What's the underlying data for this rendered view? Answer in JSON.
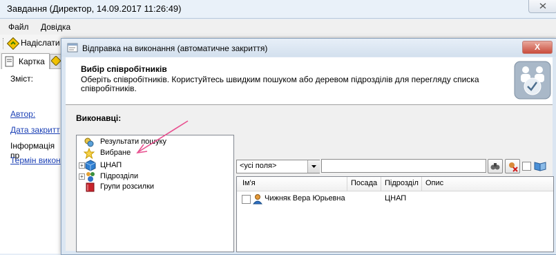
{
  "main_window": {
    "title": "Завдання (Директор, 14.09.2017 11:26:49)",
    "menu": [
      "Файл",
      "Довідка"
    ],
    "toolbar": {
      "send_label": "Надіслати"
    },
    "tab": {
      "label": "Картка"
    },
    "fields": {
      "content_label": "Зміст:",
      "author_link": "Автор:",
      "close_date_link": "Дата закритт",
      "info_label": "Інформація пр",
      "deadline_link": "Термін викон"
    }
  },
  "dialog": {
    "title": "Відправка на виконання (автоматичне закриття)",
    "header_title": "Вибір співробітників",
    "header_desc_line1": "Оберіть співробітників. Користуйтесь швидким пошуком або деревом підрозділів для перегляду списка",
    "header_desc_line2": "співробітників.",
    "executors_label": "Виконавці:",
    "close_glyph": "X",
    "tree": [
      {
        "label": "Результати пошуку",
        "icon": "search-results-icon",
        "expandable": false
      },
      {
        "label": "Вибране",
        "icon": "star-icon",
        "expandable": false
      },
      {
        "label": "ЦНАП",
        "icon": "cube-icon",
        "expandable": true
      },
      {
        "label": "Підрозділи",
        "icon": "departments-icon",
        "expandable": true
      },
      {
        "label": "Групи розсилки",
        "icon": "book-icon",
        "expandable": false
      }
    ],
    "search": {
      "field_select": "<усі поля>",
      "query": ""
    },
    "grid": {
      "columns": [
        "Ім'я",
        "Посада",
        "Підрозділ",
        "Опис"
      ],
      "rows": [
        {
          "name": "Чижняк Вера Юрьевна",
          "position": "",
          "department": "ЦНАП",
          "description": ""
        }
      ]
    }
  },
  "colors": {
    "arrow": "#e8508f",
    "link": "#1a3fb5",
    "dialog_border": "#8aa2bd"
  }
}
